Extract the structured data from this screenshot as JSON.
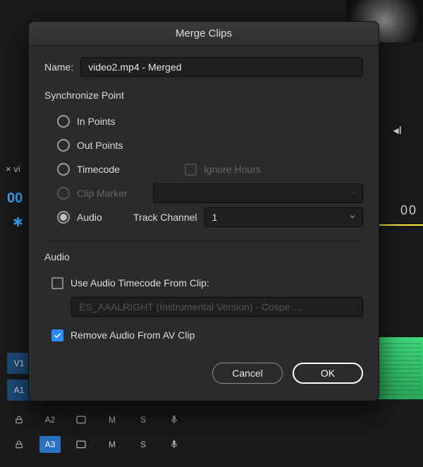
{
  "bg": {
    "x_label": "vi",
    "blue_num": "00",
    "zeros": "00",
    "v1": "V1",
    "a1": "A1",
    "a2": "A2",
    "a3": "A3",
    "m": "M",
    "s": "S",
    "play_back": "◂I"
  },
  "dialog": {
    "title": "Merge Clips",
    "name_label": "Name:",
    "name_value": "video2.mp4 - Merged",
    "sync": {
      "legend": "Synchronize Point",
      "in_points": "In Points",
      "out_points": "Out Points",
      "timecode": "Timecode",
      "ignore_hours": "Ignore Hours",
      "clip_marker": "Clip Marker",
      "clip_marker_select": "",
      "audio": "Audio",
      "track_channel_label": "Track Channel",
      "track_channel_value": "1"
    },
    "audio": {
      "legend": "Audio",
      "use_tc": "Use Audio Timecode From Clip:",
      "clip_select": "ES_AAALRIGHT (Instrumental Version) - Cospe….",
      "remove": "Remove Audio From AV Clip"
    },
    "buttons": {
      "cancel": "Cancel",
      "ok": "OK"
    }
  }
}
